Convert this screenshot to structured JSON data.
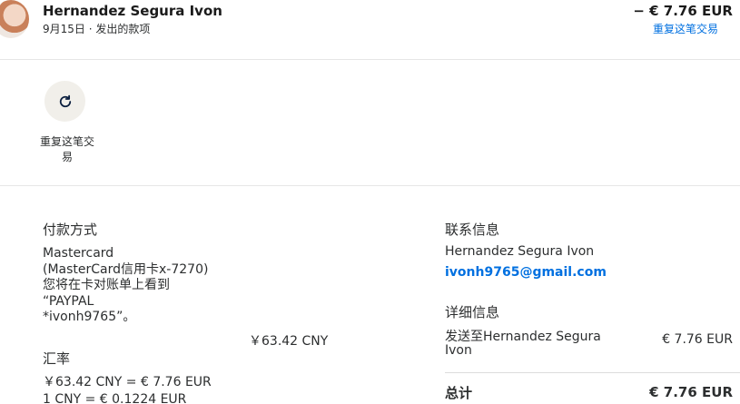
{
  "header": {
    "name": "Hernandez Segura Ivon",
    "date_type": "9月15日 · 发出的款项",
    "amount": "− € 7.76 EUR",
    "repeat_link": "重复这笔交易"
  },
  "actions": {
    "repeat_label_line1": "重复这笔交",
    "repeat_label_line2": "易",
    "repeat_icon": "refresh-icon"
  },
  "payment": {
    "title": "付款方式",
    "lines": [
      "Mastercard",
      "(MasterCard信用卡x-7270)",
      "您将在卡对账单上看到",
      "“PAYPAL",
      "*ivonh9765”。"
    ],
    "amount_cny": "￥63.42 CNY"
  },
  "exchange": {
    "title": "汇率",
    "line1": "￥63.42 CNY = € 7.76 EUR",
    "line2": "1 CNY = € 0.1224 EUR"
  },
  "contact": {
    "title": "联系信息",
    "name": "Hernandez Segura Ivon",
    "email": "ivonh9765@gmail.com"
  },
  "details": {
    "title": "详细信息",
    "line1": "发送至Hernandez Segura",
    "line2": "Ivon",
    "amount": "€ 7.76 EUR",
    "total_label": "总计",
    "total_amount": "€ 7.76 EUR"
  },
  "colors": {
    "link": "#0070e0",
    "text": "#2c2e2f",
    "circle_bg": "#f1efea"
  }
}
